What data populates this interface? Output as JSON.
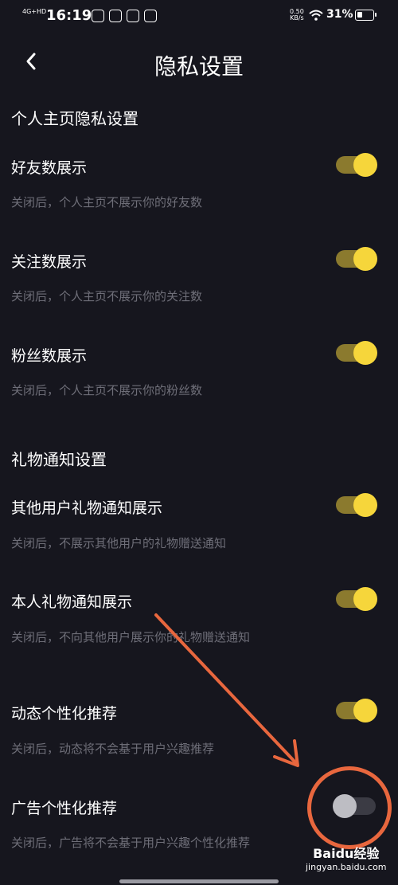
{
  "status_bar": {
    "network": "4G+HD",
    "time": "16:19",
    "speed_value": "0.50",
    "speed_unit": "KB/s",
    "battery_percent": "31%",
    "battery_level": 0.31
  },
  "header": {
    "title": "隐私设置"
  },
  "sections": [
    {
      "title": "个人主页隐私设置",
      "items": [
        {
          "title": "好友数展示",
          "desc": "关闭后，个人主页不展示你的好友数",
          "enabled": true
        },
        {
          "title": "关注数展示",
          "desc": "关闭后，个人主页不展示你的关注数",
          "enabled": true
        },
        {
          "title": "粉丝数展示",
          "desc": "关闭后，个人主页不展示你的粉丝数",
          "enabled": true
        }
      ]
    },
    {
      "title": "礼物通知设置",
      "items": [
        {
          "title": "其他用户礼物通知展示",
          "desc": "关闭后，不展示其他用户的礼物赠送通知",
          "enabled": true
        },
        {
          "title": "本人礼物通知展示",
          "desc": "关闭后，不向其他用户展示你的礼物赠送通知",
          "enabled": true
        }
      ]
    },
    {
      "title": "",
      "items": [
        {
          "title": "动态个性化推荐",
          "desc": "关闭后，动态将不会基于用户兴趣推荐",
          "enabled": true
        },
        {
          "title": "广告个性化推荐",
          "desc": "关闭后，广告将不会基于用户兴趣个性化推荐",
          "enabled": false
        }
      ]
    }
  ],
  "watermark": {
    "brand": "Baidu经验",
    "url": "jingyan.baidu.com"
  },
  "colors": {
    "background": "#16161e",
    "toggle_on_track": "#8b7a2e",
    "toggle_on_knob": "#f6d63b",
    "toggle_off_track": "#3b3b44",
    "toggle_off_knob": "#bdbdc3",
    "annotation": "#e8673e"
  }
}
